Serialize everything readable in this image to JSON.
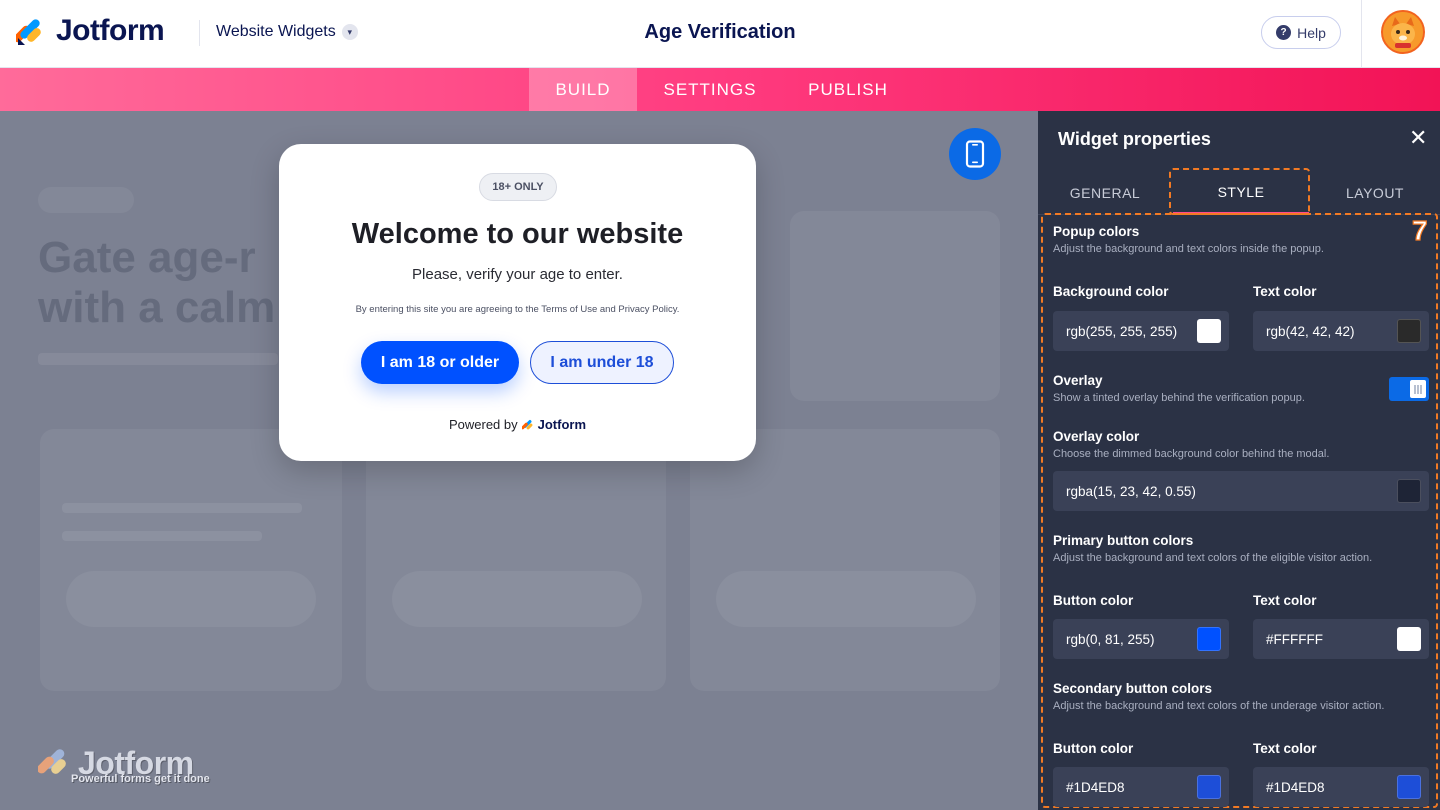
{
  "header": {
    "brand": "Jotform",
    "breadcrumb": "Website Widgets",
    "title": "Age Verification",
    "help_label": "Help"
  },
  "nav": {
    "tabs": [
      {
        "label": "BUILD",
        "active": true
      },
      {
        "label": "SETTINGS",
        "active": false
      },
      {
        "label": "PUBLISH",
        "active": false
      }
    ]
  },
  "preview": {
    "background_heading": "Gate age-r with a calm",
    "modal": {
      "badge": "18+ ONLY",
      "title": "Welcome to our website",
      "subtitle": "Please, verify your age to enter.",
      "fine_print": "By entering this site you are agreeing to the Terms of Use and Privacy Policy.",
      "primary_button": "I am 18 or older",
      "secondary_button": "I am under 18",
      "powered_by": "Powered by",
      "powered_brand": "Jotform"
    },
    "watermark": {
      "brand": "Jotform",
      "tagline": "Powerful forms get it done"
    }
  },
  "panel": {
    "title": "Widget properties",
    "close_icon": "close-icon",
    "tabs": [
      {
        "label": "GENERAL",
        "active": false
      },
      {
        "label": "STYLE",
        "active": true
      },
      {
        "label": "LAYOUT",
        "active": false
      }
    ],
    "step_number": "7",
    "popup_colors": {
      "title": "Popup colors",
      "desc": "Adjust the background and text colors inside the popup.",
      "bg_label": "Background color",
      "bg_value": "rgb(255, 255, 255)",
      "bg_swatch": "#ffffff",
      "text_label": "Text color",
      "text_value": "rgb(42, 42, 42)",
      "text_swatch": "#2a2a2a"
    },
    "overlay": {
      "title": "Overlay",
      "desc": "Show a tinted overlay behind the verification popup.",
      "enabled": true
    },
    "overlay_color": {
      "title": "Overlay color",
      "desc": "Choose the dimmed background color behind the modal.",
      "value": "rgba(15, 23, 42, 0.55)",
      "swatch": "#1e2436"
    },
    "primary_colors": {
      "title": "Primary button colors",
      "desc": "Adjust the background and text colors of the eligible visitor action.",
      "btn_label": "Button color",
      "btn_value": "rgb(0, 81, 255)",
      "btn_swatch": "#0051ff",
      "text_label": "Text color",
      "text_value": "#FFFFFF",
      "text_swatch": "#ffffff"
    },
    "secondary_colors": {
      "title": "Secondary button colors",
      "desc": "Adjust the background and text colors of the underage visitor action.",
      "btn_label": "Button color",
      "btn_value": "#1D4ED8",
      "btn_swatch": "#1d4ed8",
      "text_label": "Text color",
      "text_value": "#1D4ED8",
      "text_swatch": "#1d4ed8"
    }
  },
  "colors": {
    "brand_navy": "#0a1551",
    "accent_pink": "#ff3b7f",
    "primary_blue": "#0051ff",
    "panel_bg": "#2b3245",
    "highlight_orange": "#f27a24"
  }
}
